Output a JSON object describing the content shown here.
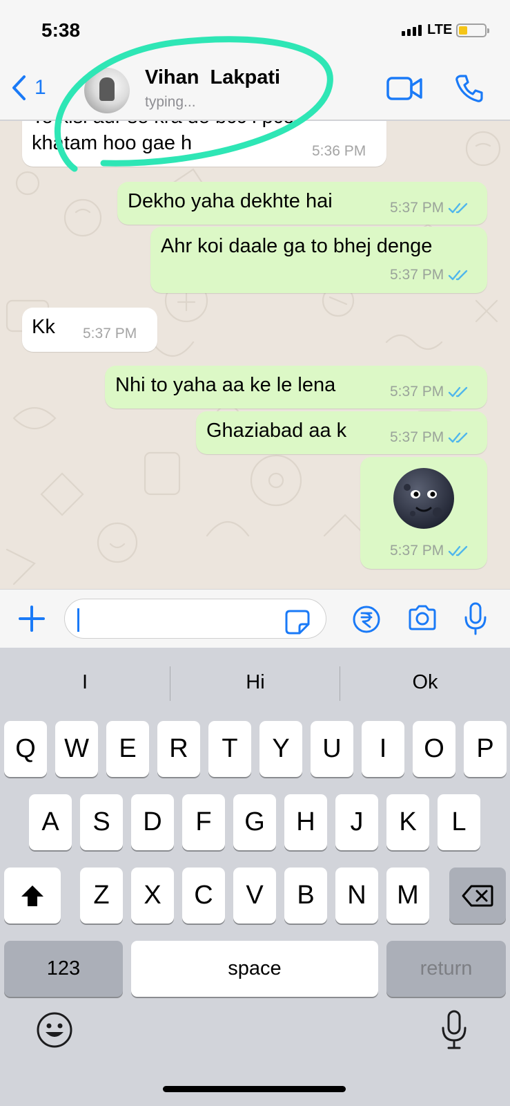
{
  "status_bar": {
    "time": "5:38",
    "network": "LTE"
  },
  "header": {
    "back_count": "1",
    "contact_name": "Vihan  Lakpati",
    "contact_status": "typing..."
  },
  "messages": [
    {
      "direction": "in",
      "text_partial": "To kisi aur se kra de bcc i pco",
      "text": "khatam hoo gae h",
      "time": "5:36 PM"
    },
    {
      "direction": "out",
      "text": "Dekho yaha dekhte hai",
      "time": "5:37 PM"
    },
    {
      "direction": "out",
      "text": "Ahr koi daale ga to bhej denge",
      "time": "5:37 PM"
    },
    {
      "direction": "in",
      "text": "Kk",
      "time": "5:37 PM"
    },
    {
      "direction": "out",
      "text": "Nhi to yaha aa ke le lena",
      "time": "5:37 PM"
    },
    {
      "direction": "out",
      "text": "Ghaziabad aa k",
      "time": "5:37 PM"
    },
    {
      "direction": "out",
      "text": "🌚",
      "time": "5:37 PM"
    }
  ],
  "keyboard": {
    "suggestions": [
      "I",
      "Hi",
      "Ok"
    ],
    "row1": [
      "Q",
      "W",
      "E",
      "R",
      "T",
      "Y",
      "U",
      "I",
      "O",
      "P"
    ],
    "row2": [
      "A",
      "S",
      "D",
      "F",
      "G",
      "H",
      "J",
      "K",
      "L"
    ],
    "row3": [
      "Z",
      "X",
      "C",
      "V",
      "B",
      "N",
      "M"
    ],
    "numbers_label": "123",
    "space_label": "space",
    "return_label": "return"
  },
  "colors": {
    "accent": "#1a7af7",
    "outgoing_bubble": "#dcf8c6",
    "incoming_bubble": "#ffffff",
    "annotation": "#2ee6b5",
    "battery": "#f5c518"
  },
  "icons": {
    "header": [
      "back-chevron-icon",
      "video-call-icon",
      "phone-call-icon"
    ],
    "input": [
      "plus-icon",
      "sticker-icon",
      "rupee-payment-icon",
      "camera-icon",
      "microphone-icon"
    ],
    "keyboard": [
      "shift-icon",
      "backspace-icon",
      "emoji-icon",
      "dictation-icon"
    ]
  }
}
